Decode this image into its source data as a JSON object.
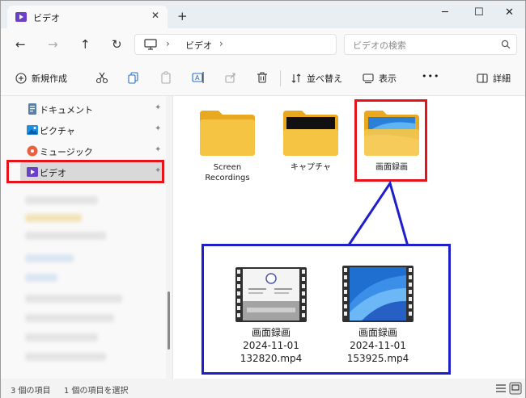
{
  "tab": {
    "title": "ビデオ",
    "close": "✕",
    "new_tab": "+"
  },
  "window_controls": {
    "minimize": "─",
    "maximize": "☐",
    "close": "✕"
  },
  "nav": {
    "back": "←",
    "forward": "→",
    "up": "↑",
    "refresh": "↻"
  },
  "address": {
    "separator": "›",
    "location": "ビデオ"
  },
  "search": {
    "placeholder": "ビデオの検索"
  },
  "commands": {
    "new": "新規作成",
    "sort": "並べ替え",
    "view": "表示",
    "more": "•••",
    "details": "詳細"
  },
  "sidebar": {
    "items": [
      {
        "label": "ドキュメント",
        "icon": "documents-icon",
        "pinned": true
      },
      {
        "label": "ピクチャ",
        "icon": "pictures-icon",
        "pinned": true
      },
      {
        "label": "ミュージック",
        "icon": "music-icon",
        "pinned": true
      },
      {
        "label": "ビデオ",
        "icon": "videos-icon",
        "pinned": true,
        "selected": true
      }
    ],
    "pin_glyph": "✦"
  },
  "folders": [
    {
      "line1": "Screen",
      "line2": "Recordings"
    },
    {
      "line1": "キャプチャ",
      "line2": ""
    },
    {
      "line1": "画面録画",
      "line2": ""
    }
  ],
  "callout_files": [
    {
      "name": "画面録画",
      "date": "2024-11-01",
      "file": "132820.mp4"
    },
    {
      "name": "画面録画",
      "date": "2024-11-01",
      "file": "153925.mp4"
    }
  ],
  "status": {
    "count": "3 個の項目",
    "selected": "1 個の項目を選択"
  },
  "colors": {
    "highlight_red": "#e5141c",
    "callout_blue": "#1e1ecb",
    "folder_yellow": "#f6c443",
    "accent": "#0067c0"
  }
}
